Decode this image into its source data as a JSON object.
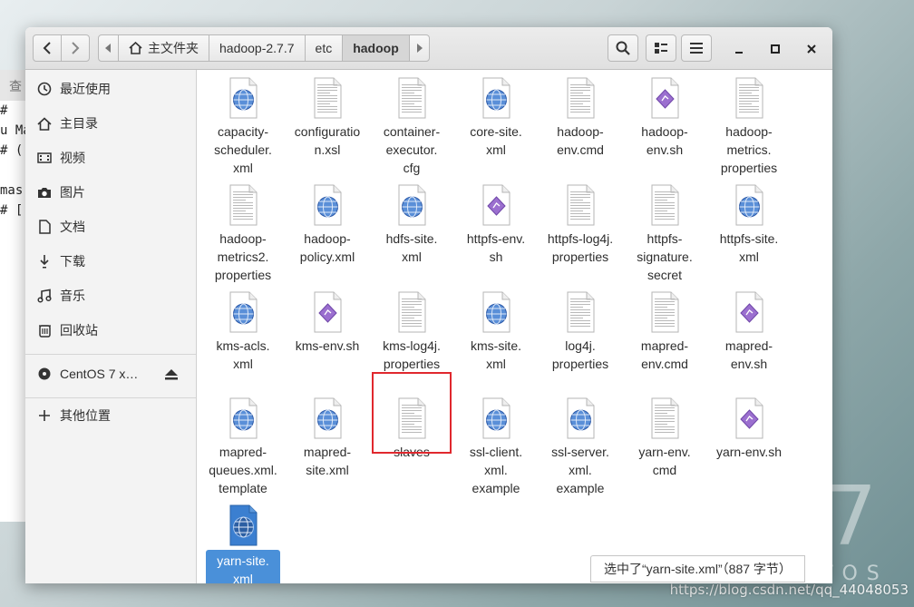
{
  "desktop": {
    "watermark": "https://blog.csdn.net/qq_44048053",
    "logo_text": "TOS",
    "logo_seven": "7"
  },
  "terminal": {
    "tab": "查",
    "lines": [
      "# ",
      "u Ma",
      "# (",
      "",
      "mas",
      "# ["
    ]
  },
  "toolbar": {
    "path": [
      "主文件夹",
      "hadoop-2.7.7",
      "etc",
      "hadoop"
    ],
    "active_index": 3
  },
  "sidebar": {
    "places": [
      {
        "label": "最近使用",
        "icon": "clock-icon"
      },
      {
        "label": "主目录",
        "icon": "home-icon"
      },
      {
        "label": "视频",
        "icon": "video-icon"
      },
      {
        "label": "图片",
        "icon": "camera-icon"
      },
      {
        "label": "文档",
        "icon": "document-icon"
      },
      {
        "label": "下载",
        "icon": "download-icon"
      },
      {
        "label": "音乐",
        "icon": "music-icon"
      },
      {
        "label": "回收站",
        "icon": "trash-icon"
      }
    ],
    "device": {
      "label": "CentOS 7 x…",
      "icon": "disc-icon"
    },
    "other": {
      "label": "其他位置",
      "icon": "plus-icon"
    }
  },
  "files": [
    {
      "name": "capacity-\nscheduler.\nxml",
      "type": "xml"
    },
    {
      "name": "configuratio\nn.xsl",
      "type": "text"
    },
    {
      "name": "container-\nexecutor.\ncfg",
      "type": "text"
    },
    {
      "name": "core-site.\nxml",
      "type": "xml"
    },
    {
      "name": "hadoop-\nenv.cmd",
      "type": "text"
    },
    {
      "name": "hadoop-\nenv.sh",
      "type": "script"
    },
    {
      "name": "hadoop-\nmetrics.\nproperties",
      "type": "text"
    },
    {
      "name": "hadoop-\nmetrics2.\nproperties",
      "type": "text"
    },
    {
      "name": "hadoop-\npolicy.xml",
      "type": "xml"
    },
    {
      "name": "hdfs-site.\nxml",
      "type": "xml"
    },
    {
      "name": "httpfs-env.\nsh",
      "type": "script"
    },
    {
      "name": "httpfs-log4j.\nproperties",
      "type": "text"
    },
    {
      "name": "httpfs-\nsignature.\nsecret",
      "type": "text"
    },
    {
      "name": "httpfs-site.\nxml",
      "type": "xml"
    },
    {
      "name": "kms-acls.\nxml",
      "type": "xml"
    },
    {
      "name": "kms-env.sh",
      "type": "script"
    },
    {
      "name": "kms-log4j.\nproperties",
      "type": "text"
    },
    {
      "name": "kms-site.\nxml",
      "type": "xml"
    },
    {
      "name": "log4j.\nproperties",
      "type": "text"
    },
    {
      "name": "mapred-\nenv.cmd",
      "type": "text"
    },
    {
      "name": "mapred-\nenv.sh",
      "type": "script"
    },
    {
      "name": "mapred-\nqueues.xml.\ntemplate",
      "type": "xml"
    },
    {
      "name": "mapred-\nsite.xml",
      "type": "xml"
    },
    {
      "name": "slaves",
      "type": "text"
    },
    {
      "name": "ssl-client.\nxml.\nexample",
      "type": "xml"
    },
    {
      "name": "ssl-server.\nxml.\nexample",
      "type": "xml"
    },
    {
      "name": "yarn-env.\ncmd",
      "type": "text"
    },
    {
      "name": "yarn-env.sh",
      "type": "script"
    },
    {
      "name": "yarn-site.\nxml",
      "type": "xml",
      "selected": true
    }
  ],
  "status": "选中了“yarn-site.xml”（887 字节）",
  "colors": {
    "selection": "#4a90d9",
    "highlight": "#e0282e"
  }
}
